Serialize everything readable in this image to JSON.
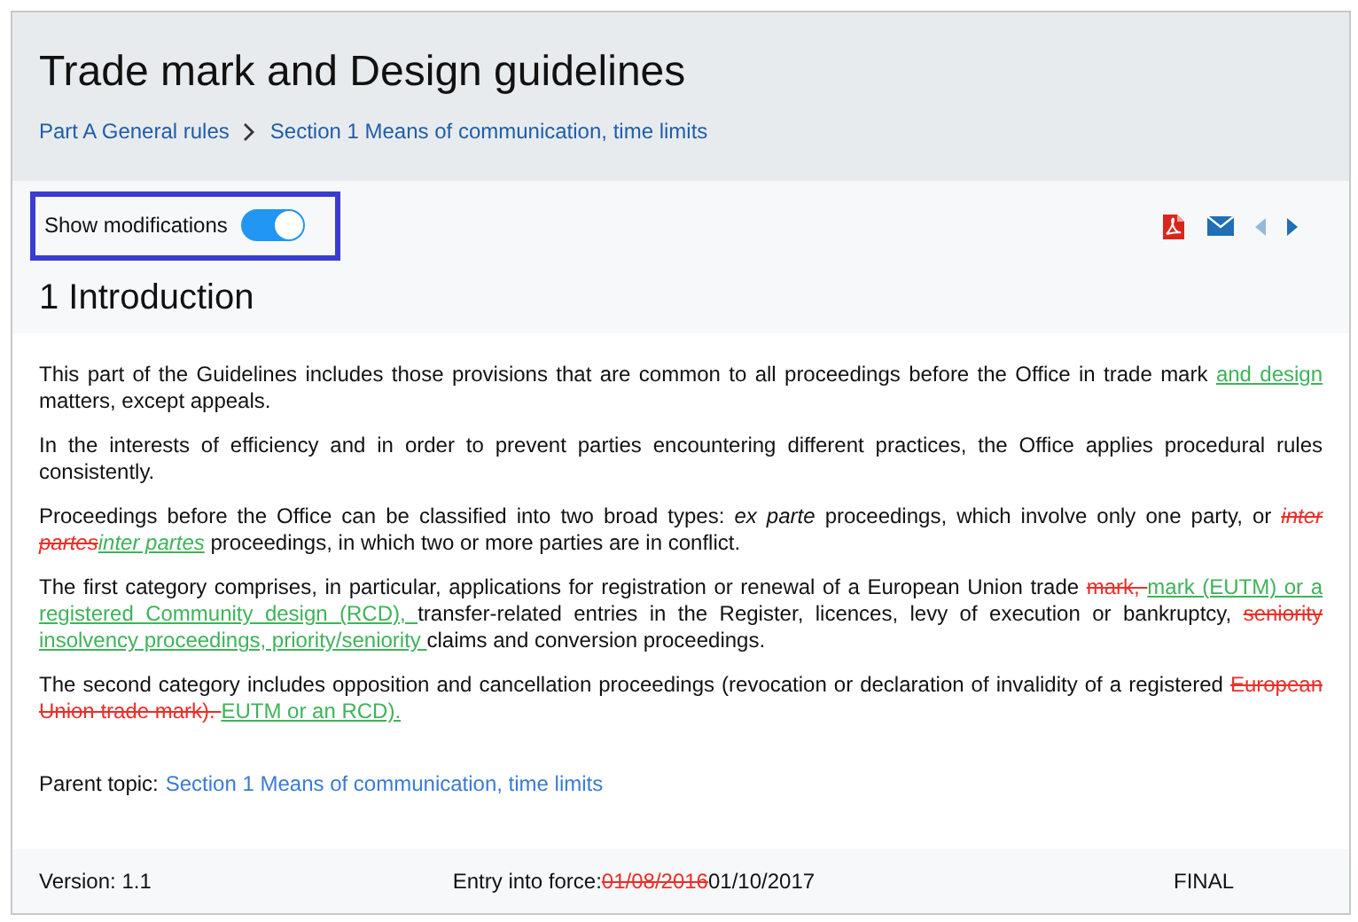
{
  "header": {
    "title": "Trade mark and Design guidelines",
    "breadcrumb": [
      {
        "label": "Part A General rules"
      },
      {
        "label": "Section 1 Means of communication, time limits"
      }
    ]
  },
  "toggle": {
    "label": "Show modifications",
    "on": true,
    "highlighted": true
  },
  "toolbar": [
    {
      "kind": "pdf",
      "disabled": false
    },
    {
      "kind": "mail",
      "disabled": false
    },
    {
      "kind": "prev",
      "disabled": true
    },
    {
      "kind": "next",
      "disabled": false
    }
  ],
  "heading": "1 Introduction",
  "paragraphs": [
    [
      {
        "kind": "plain",
        "text": "This part of the Guidelines includes those provisions that are common to all proceedings before the Office in trade mark "
      },
      {
        "kind": "ins",
        "text": "and design "
      },
      {
        "kind": "plain",
        "text": "matters, except appeals."
      }
    ],
    [
      {
        "kind": "plain",
        "text": "In the interests of efficiency and in order to prevent parties encountering different practices, the Office applies procedural rules consistently."
      }
    ],
    [
      {
        "kind": "plain",
        "text": "Proceedings before the Office can be classified into two broad types: "
      },
      {
        "kind": "italic",
        "text": "ex parte"
      },
      {
        "kind": "plain",
        "text": " proceedings, which involve only one party, or "
      },
      {
        "kind": "del-italic",
        "text": "inter partes"
      },
      {
        "kind": "ins-italic",
        "text": "inter partes"
      },
      {
        "kind": "plain",
        "text": " proceedings, in which two or more parties are in conflict."
      }
    ],
    [
      {
        "kind": "plain",
        "text": "The first category comprises, in particular, applications for registration or renewal of a European Union trade "
      },
      {
        "kind": "del",
        "text": "mark, "
      },
      {
        "kind": "ins",
        "text": "mark (EUTM) or a registered Community design (RCD), "
      },
      {
        "kind": "plain",
        "text": "transfer-related entries in the Register, licences, levy of execution or bankruptcy, "
      },
      {
        "kind": "del",
        "text": "seniority "
      },
      {
        "kind": "ins",
        "text": "insolvency proceedings, priority/seniority "
      },
      {
        "kind": "plain",
        "text": "claims and conversion proceedings."
      }
    ],
    [
      {
        "kind": "plain",
        "text": "The second category includes opposition and cancellation proceedings (revocation or declaration of invalidity of a registered "
      },
      {
        "kind": "del",
        "text": "European Union trade mark). "
      },
      {
        "kind": "ins",
        "text": "EUTM or an RCD)."
      }
    ]
  ],
  "parent_topic": {
    "label": "Parent topic:",
    "link": "Section 1 Means of communication, time limits"
  },
  "footer": {
    "version": "Version: 1.1",
    "entry": [
      {
        "kind": "plain",
        "text": "Entry into force:"
      },
      {
        "kind": "del",
        "text": "01/08/2016"
      },
      {
        "kind": "plain",
        "text": "01/10/2017"
      }
    ],
    "status": "FINAL"
  }
}
